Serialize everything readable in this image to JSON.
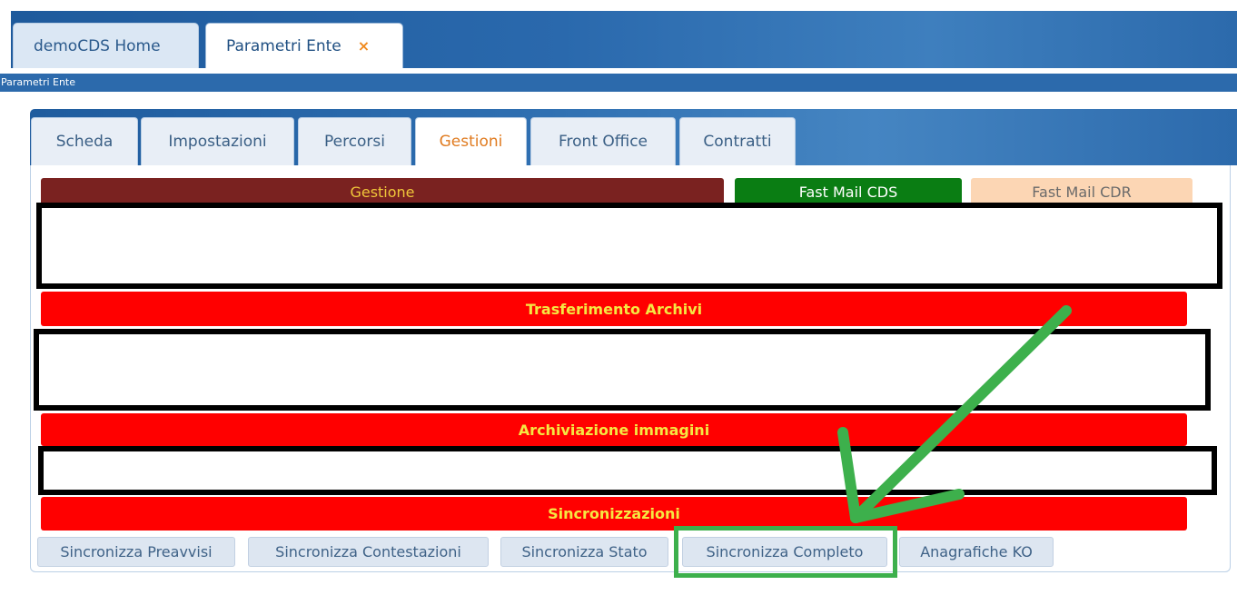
{
  "window": {
    "tabs": [
      {
        "label": "demoCDS Home"
      },
      {
        "label": "Parametri Ente",
        "close": "×"
      }
    ],
    "breadcrumb": "Parametri Ente"
  },
  "subtabs": [
    "Scheda",
    "Impostazioni",
    "Percorsi",
    "Gestioni",
    "Front Office",
    "Contratti"
  ],
  "active_subtab": "Gestioni",
  "sections": {
    "gestione": "Gestione",
    "fast_mail_cds": "Fast Mail CDS",
    "fast_mail_cdr": "Fast Mail CDR",
    "trasferimento": "Trasferimento Archivi",
    "archiviazione": "Archiviazione immagini",
    "sincronizzazioni": "Sincronizzazioni"
  },
  "buttons": {
    "preavvisi": "Sincronizza Preavvisi",
    "contestazioni": "Sincronizza Contestazioni",
    "stato": "Sincronizza Stato",
    "completo": "Sincronizza Completo",
    "anagrafiche": "Anagrafiche KO"
  },
  "colors": {
    "tab_bar": "#2a69ad",
    "gestione_header": "#7a2220",
    "fast_mail_cds": "#0a7d13",
    "fast_mail_cdr": "#fcd6b4",
    "section_header": "#ff0000",
    "annotation": "#3db04c"
  }
}
